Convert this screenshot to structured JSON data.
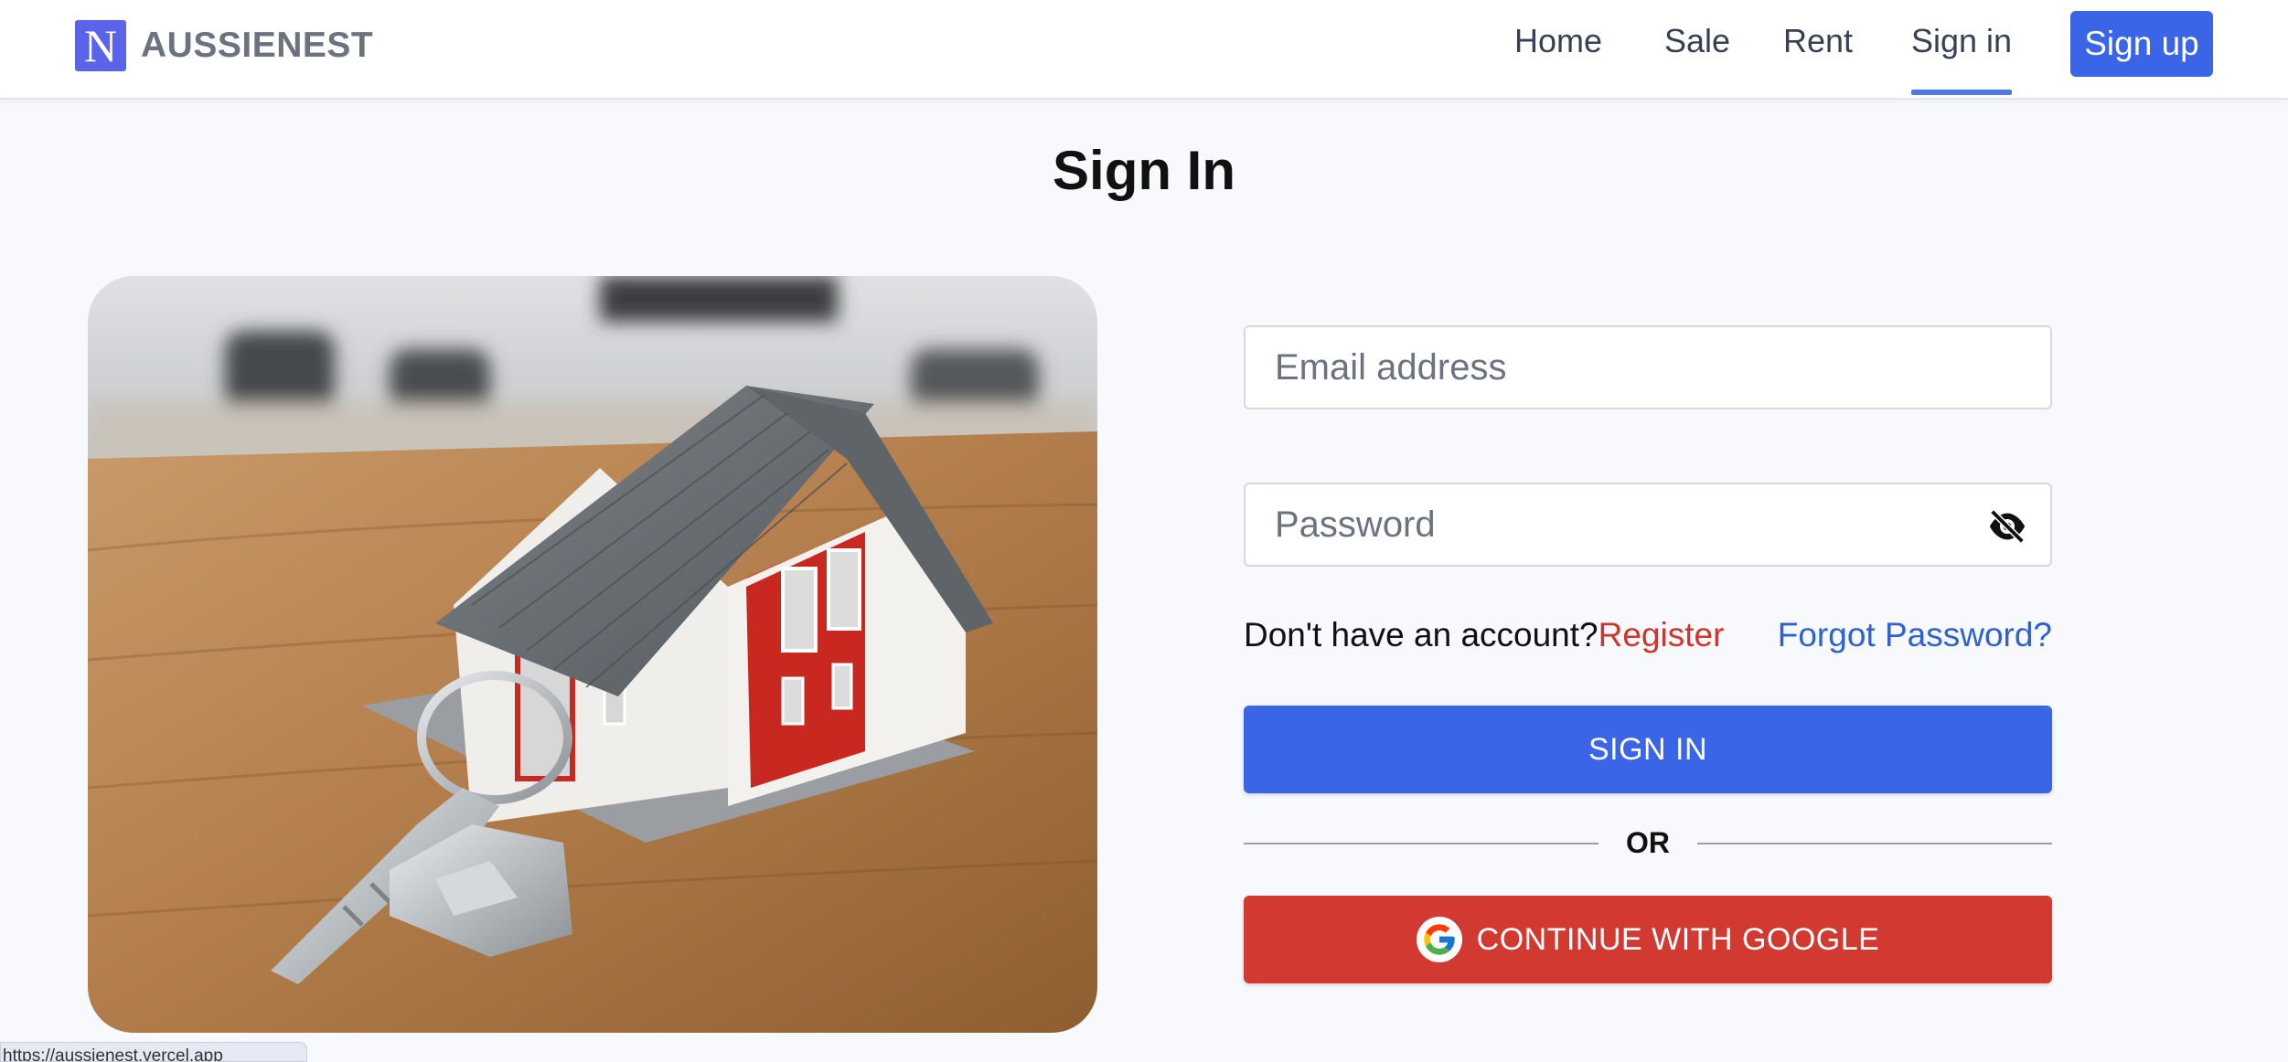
{
  "header": {
    "logo_letter": "N",
    "brand": "AUSSIENEST",
    "nav": [
      {
        "label": "Home"
      },
      {
        "label": "Sale"
      },
      {
        "label": "Rent"
      },
      {
        "label": "Sign in",
        "active": true
      }
    ],
    "signup_label": "Sign up"
  },
  "page": {
    "title": "Sign In"
  },
  "hero": {
    "icon": "house-with-keys-photo"
  },
  "form": {
    "email_placeholder": "Email address",
    "password_placeholder": "Password",
    "password_toggle_icon": "eye-off-icon",
    "no_account_text": "Don't have an account?",
    "register_label": "Register",
    "forgot_label": "Forgot Password?",
    "signin_label": "SIGN IN",
    "or_label": "OR",
    "google_label": "CONTINUE WITH GOOGLE"
  },
  "status": {
    "url": "https://aussienest.vercel.app"
  },
  "colors": {
    "primary": "#3a65e6",
    "google": "#d23a31",
    "register": "#d0352c",
    "link": "#2f61d3",
    "logo": "#5b63e8"
  }
}
